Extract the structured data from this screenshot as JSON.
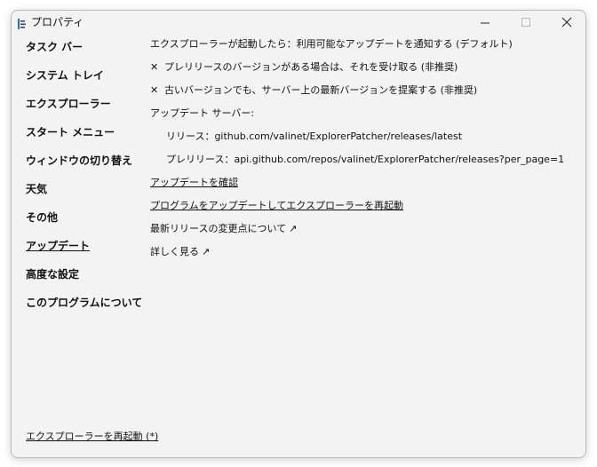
{
  "window": {
    "title": "プロパティ"
  },
  "sidebar": {
    "items": [
      {
        "label": "タスク バー"
      },
      {
        "label": "システム トレイ"
      },
      {
        "label": "エクスプローラー"
      },
      {
        "label": "スタート メニュー"
      },
      {
        "label": "ウィンドウの切り替え"
      },
      {
        "label": "天気"
      },
      {
        "label": "その他"
      },
      {
        "label": "アップデート",
        "selected": true
      },
      {
        "label": "高度な設定"
      },
      {
        "label": "このプログラムについて"
      }
    ],
    "restart_link": "エクスプローラーを再起動 (*)"
  },
  "main": {
    "notify_option": "エクスプローラーが起動したら：利用可能なアップデートを通知する (デフォルト)",
    "option_prerelease": {
      "checked": false,
      "label": "プレリリースのバージョンがある場合は、それを受け取る (非推奨)"
    },
    "option_suggest_latest": {
      "checked": false,
      "label": "古いバージョンでも、サーバー上の最新バージョンを提案する (非推奨)"
    },
    "update_server_heading": "アップデート サーバー:",
    "release_url_text": "リリース：github.com/valinet/ExplorerPatcher/releases/latest",
    "prerelease_url_text": "プレリリース：api.github.com/repos/valinet/ExplorerPatcher/releases?per_page=1",
    "check_updates_link": "アップデートを確認",
    "update_restart_link": "プログラムをアップデートしてエクスプローラーを再起動",
    "changelog_link": "最新リリースの変更点について",
    "learn_more_link": "詳しく見る",
    "external_arrow": "↗",
    "x_mark": "✕"
  }
}
